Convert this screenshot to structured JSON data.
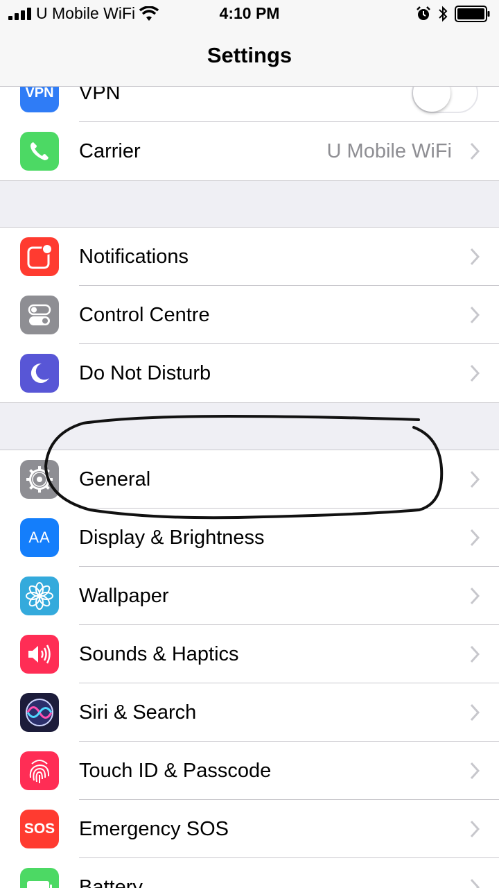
{
  "status_bar": {
    "carrier": "U Mobile WiFi",
    "time": "4:10 PM"
  },
  "nav": {
    "title": "Settings"
  },
  "group1": [
    {
      "label": "VPN",
      "icon": "vpn-icon",
      "icon_text": "VPN",
      "color": "#2f7cf6",
      "toggle": "off"
    },
    {
      "label": "Carrier",
      "value": "U Mobile WiFi",
      "icon": "phone-icon",
      "color": "#4cd964"
    }
  ],
  "group2": [
    {
      "label": "Notifications",
      "icon": "notifications-icon",
      "color": "#ff3b30"
    },
    {
      "label": "Control Centre",
      "icon": "control-centre-icon",
      "color": "#8e8e93"
    },
    {
      "label": "Do Not Disturb",
      "icon": "moon-icon",
      "color": "#5856d6"
    }
  ],
  "group3": [
    {
      "label": "General",
      "icon": "gear-icon",
      "color": "#8e8e93"
    },
    {
      "label": "Display & Brightness",
      "icon": "text-size-icon",
      "icon_text": "AA",
      "color": "#147efb"
    },
    {
      "label": "Wallpaper",
      "icon": "flower-icon",
      "color": "#34aadc"
    },
    {
      "label": "Sounds & Haptics",
      "icon": "speaker-icon",
      "color": "#ff2d55"
    },
    {
      "label": "Siri & Search",
      "icon": "siri-icon",
      "color": "#1c1c3a"
    },
    {
      "label": "Touch ID & Passcode",
      "icon": "fingerprint-icon",
      "color": "#ff2d55"
    },
    {
      "label": "Emergency SOS",
      "icon": "sos-icon",
      "icon_text": "SOS",
      "color": "#ff3b30"
    },
    {
      "label": "Battery",
      "icon": "battery-setting-icon",
      "color": "#4cd964"
    }
  ]
}
